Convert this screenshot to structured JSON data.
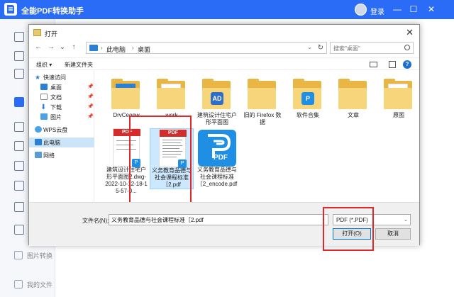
{
  "app": {
    "title": "全能PDF转换助手",
    "login": "登录",
    "minimize": "—",
    "maximize": "☐",
    "close": "✕",
    "sidebar_bottom": [
      {
        "label": "图片转换",
        "icon": "image-convert-icon"
      },
      {
        "label": "我的文件",
        "icon": "my-files-icon"
      }
    ]
  },
  "dialog": {
    "title": "打开",
    "close": "✕",
    "nav": {
      "back": "←",
      "forward": "→",
      "recent": "⌄",
      "up": "↑"
    },
    "breadcrumb": [
      "此电脑",
      "桌面"
    ],
    "breadcrumb_sep": "›",
    "search_placeholder": "搜索\"桌面\"",
    "toolbar": {
      "organize": "组织 ▾",
      "new_folder": "新建文件夹",
      "help": "?"
    },
    "nav_pane": [
      {
        "label": "快速访问",
        "icon": "star-icon",
        "pinned": false
      },
      {
        "label": "桌面",
        "icon": "desktop-icon",
        "pinned": true
      },
      {
        "label": "文档",
        "icon": "documents-icon",
        "pinned": true
      },
      {
        "label": "下载",
        "icon": "download-icon",
        "pinned": true
      },
      {
        "label": "图片",
        "icon": "pictures-icon",
        "pinned": true
      },
      {
        "label": "WPS云盘",
        "icon": "wps-cloud-icon",
        "pinned": false
      },
      {
        "label": "此电脑",
        "icon": "this-pc-icon",
        "pinned": false,
        "selected": true
      },
      {
        "label": "网络",
        "icon": "network-icon",
        "pinned": false
      }
    ],
    "files_row1": [
      {
        "label": "DrvCeonw",
        "type": "folder",
        "badge": "",
        "badge_color": "#2a7fd6"
      },
      {
        "label": "work",
        "type": "folder",
        "badge": "",
        "badge_color": ""
      },
      {
        "label": "建筑设计住宅户形平面图",
        "type": "folder",
        "badge": "AD",
        "badge_color": "#2f6ec8"
      },
      {
        "label": "旧的 Firefox 数据",
        "type": "folder",
        "badge": "",
        "badge_color": ""
      },
      {
        "label": "软件合集",
        "type": "folder",
        "badge": "P",
        "badge_color": "#1f8fe6"
      },
      {
        "label": "文章",
        "type": "folder",
        "badge": "",
        "badge_color": ""
      },
      {
        "label": "原图",
        "type": "folder",
        "badge": "",
        "badge_color": ""
      }
    ],
    "files_row2": [
      {
        "label": "建筑设计住宅户形平面图2.dwg-2022-10-12-18-15-57-0...",
        "type": "pdf",
        "tag": "PDF"
      },
      {
        "label": "义务教育品德与社会课程标准［2.pdf",
        "type": "pdf",
        "tag": "PDF",
        "selected": true
      },
      {
        "label": "义务教育品德与社会课程标准［2_encode.pdf",
        "type": "pdf-app",
        "tag": "PDF"
      }
    ],
    "filename_label": "文件名(N):",
    "filename_value": "义务教育品德与社会课程标准［2.pdf",
    "filter": "PDF (*.PDF)",
    "open_button": "打开(O)",
    "cancel_button": "取消"
  },
  "colors": {
    "accent": "#2a6cf5",
    "highlight": "#e02828",
    "folder": "#e9b545",
    "pdf_red": "#d42b2b",
    "selection": "#cce8ff"
  }
}
